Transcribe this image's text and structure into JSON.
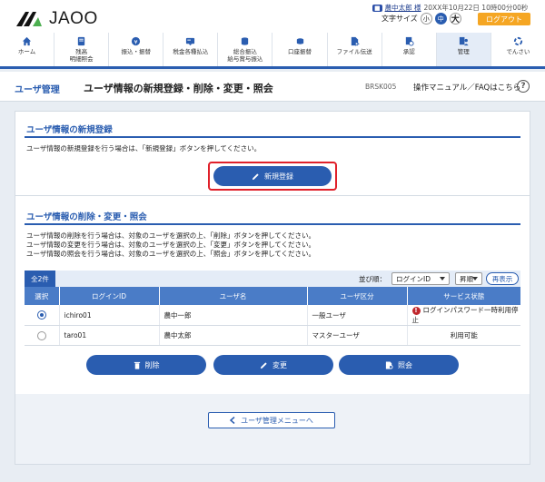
{
  "header": {
    "brand": "JAOO",
    "user_name": "農中太郎 様",
    "last_login": "20XX年10月22日 10時00分00秒",
    "font_size_label": "文字サイズ",
    "font_sizes": [
      "小",
      "中",
      "大"
    ],
    "logout_label": "ログアウト"
  },
  "nav": {
    "items": [
      {
        "label": "ホーム",
        "icon": "home-icon"
      },
      {
        "label": "残高\n明細照会",
        "icon": "passbook-icon"
      },
      {
        "label": "振込・振替",
        "icon": "yen-coin-icon"
      },
      {
        "label": "税金各種払込",
        "icon": "tax-card-icon"
      },
      {
        "label": "総合振込\n給与賞与振込",
        "icon": "coins-stack-icon"
      },
      {
        "label": "口座振替",
        "icon": "coins-icon"
      },
      {
        "label": "ファイル伝送",
        "icon": "file-transfer-icon"
      },
      {
        "label": "承認",
        "icon": "approval-icon"
      },
      {
        "label": "管理",
        "icon": "admin-user-icon"
      },
      {
        "label": "でんさい",
        "icon": "densai-icon"
      }
    ],
    "active_index": 8
  },
  "titlebar": {
    "section": "ユーザ管理",
    "page_title": "ユーザ情報の新規登録・削除・変更・照会",
    "screen_id": "BRSK005",
    "help_label": "操作マニュアル／FAQはこちら"
  },
  "register": {
    "heading": "ユーザ情報の新規登録",
    "description": "ユーザ情報の新規登録を行う場合は、「新規登録」ボタンを押してください。",
    "button_label": "新規登録"
  },
  "manage": {
    "heading": "ユーザ情報の削除・変更・照会",
    "descriptions": [
      "ユーザ情報の削除を行う場合は、対象のユーザを選択の上、「削除」ボタンを押してください。",
      "ユーザ情報の変更を行う場合は、対象のユーザを選択の上、「変更」ボタンを押してください。",
      "ユーザ情報の照会を行う場合は、対象のユーザを選択の上、「照会」ボタンを押してください。"
    ],
    "count_label": "全2件",
    "sort_label": "並び順：",
    "sort_key": "ログインID",
    "sort_order": "昇順",
    "redisplay_label": "再表示",
    "columns": [
      "選択",
      "ログインID",
      "ユーザ名",
      "ユーザ区分",
      "サービス状態"
    ],
    "rows": [
      {
        "selected": true,
        "login_id": "ichiro01",
        "user_name": "農中一郎",
        "user_type": "一般ユーザ",
        "status": "ログインパスワード一時利用停止",
        "warn": true
      },
      {
        "selected": false,
        "login_id": "taro01",
        "user_name": "農中太郎",
        "user_type": "マスターユーザ",
        "status": "利用可能",
        "warn": false
      }
    ],
    "delete_label": "削除",
    "edit_label": "変更",
    "view_label": "照会"
  },
  "footer": {
    "back_label": "ユーザ管理メニューへ"
  },
  "colors": {
    "primary": "#2a5db0",
    "accent": "#f5a623",
    "highlight": "#e0202a"
  }
}
